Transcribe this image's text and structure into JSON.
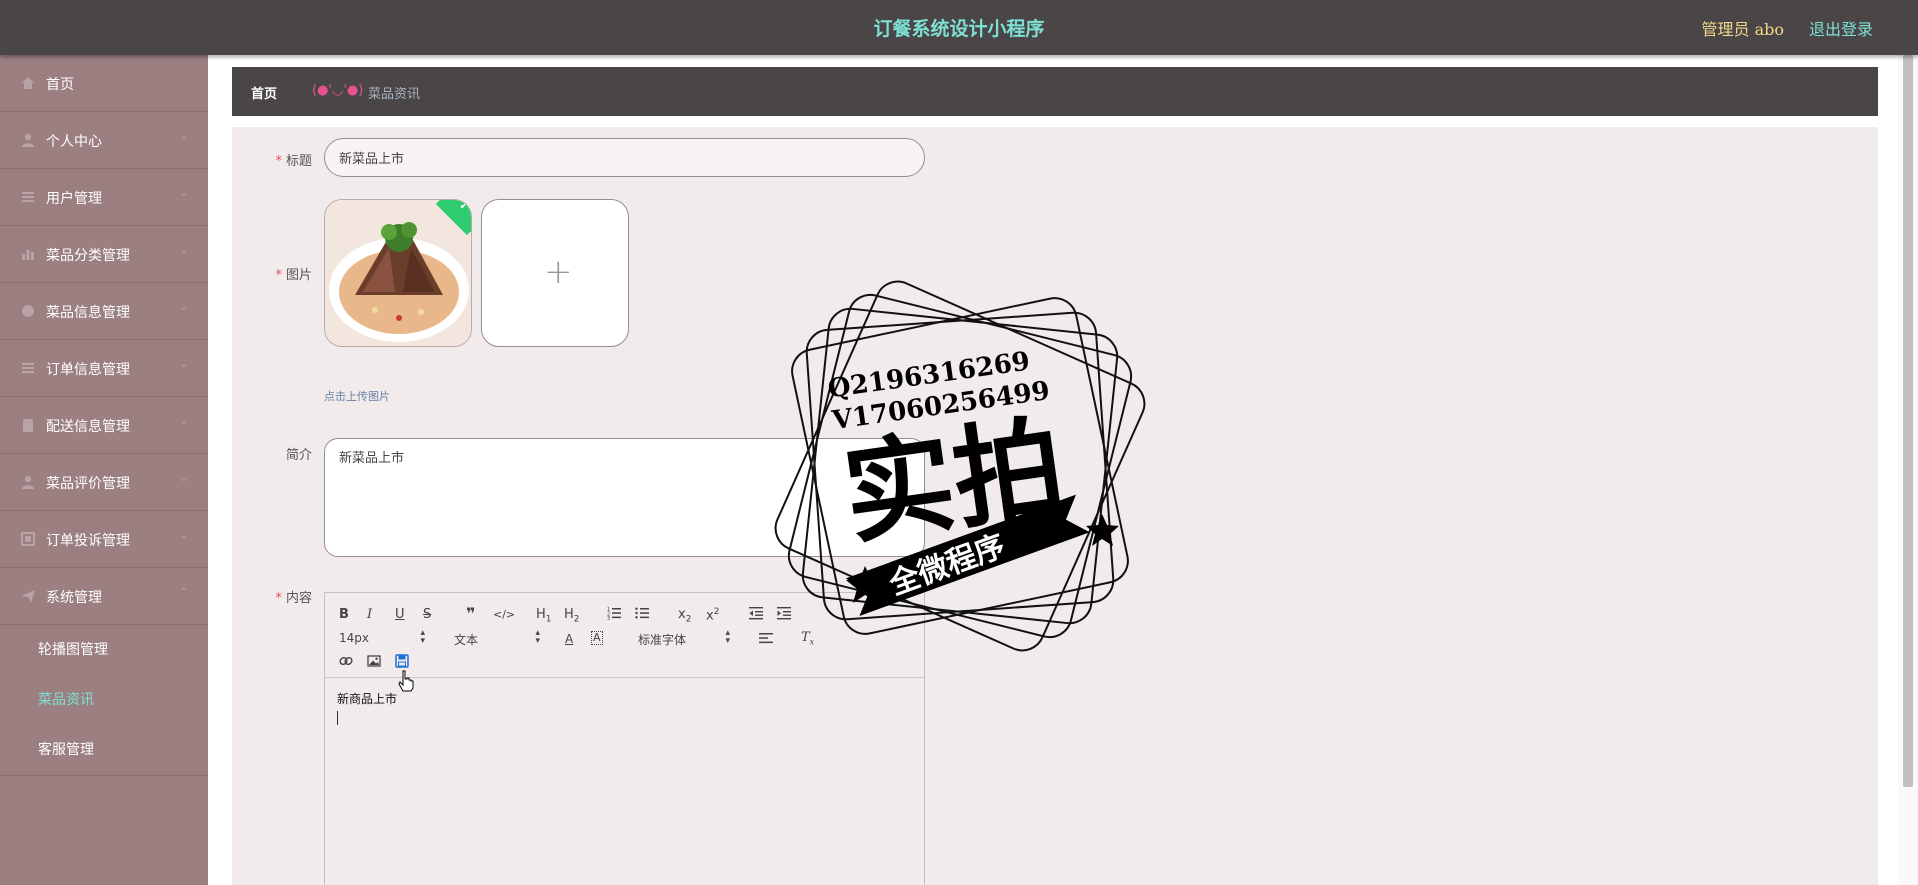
{
  "header": {
    "title": "订餐系统设计小程序",
    "admin_label": "管理员",
    "admin_name": "abo",
    "logout_label": "退出登录"
  },
  "sidebar": {
    "items": [
      {
        "label": "首页",
        "icon": "home-icon"
      },
      {
        "label": "个人中心",
        "icon": "user-icon"
      },
      {
        "label": "用户管理",
        "icon": "list-icon"
      },
      {
        "label": "菜品分类管理",
        "icon": "bar-chart-icon"
      },
      {
        "label": "菜品信息管理",
        "icon": "info-icon"
      },
      {
        "label": "订单信息管理",
        "icon": "list-icon"
      },
      {
        "label": "配送信息管理",
        "icon": "clipboard-icon"
      },
      {
        "label": "菜品评价管理",
        "icon": "user-icon"
      },
      {
        "label": "订单投诉管理",
        "icon": "grid-icon"
      },
      {
        "label": "系统管理",
        "icon": "send-icon"
      }
    ],
    "sub_items": [
      {
        "label": "轮播图管理"
      },
      {
        "label": "菜品资讯"
      },
      {
        "label": "客服管理"
      }
    ]
  },
  "breadcrumb": {
    "home": "首页",
    "separator": "(●'◡'●)",
    "current": "菜品资讯"
  },
  "form": {
    "title_label": "标题",
    "title_value": "新菜品上市",
    "image_label": "图片",
    "upload_hint": "点击上传图片",
    "intro_label": "简介",
    "intro_value": "新菜品上市",
    "content_label": "内容",
    "editor": {
      "font_size": "14px",
      "text_style": "文本",
      "font_family": "标准字体",
      "body_text": "新商品上市"
    }
  },
  "watermark": {
    "line1": "Q2196316269",
    "line2": "V17060256499",
    "big_text": "实拍",
    "ribbon_text": "全微程序"
  },
  "colors": {
    "header_bg": "#4a4546",
    "sidebar_bg": "#9b7f81",
    "accent": "#7ee0d4",
    "admin_color": "#f1d98a",
    "panel_bg": "#f1ebeb"
  }
}
